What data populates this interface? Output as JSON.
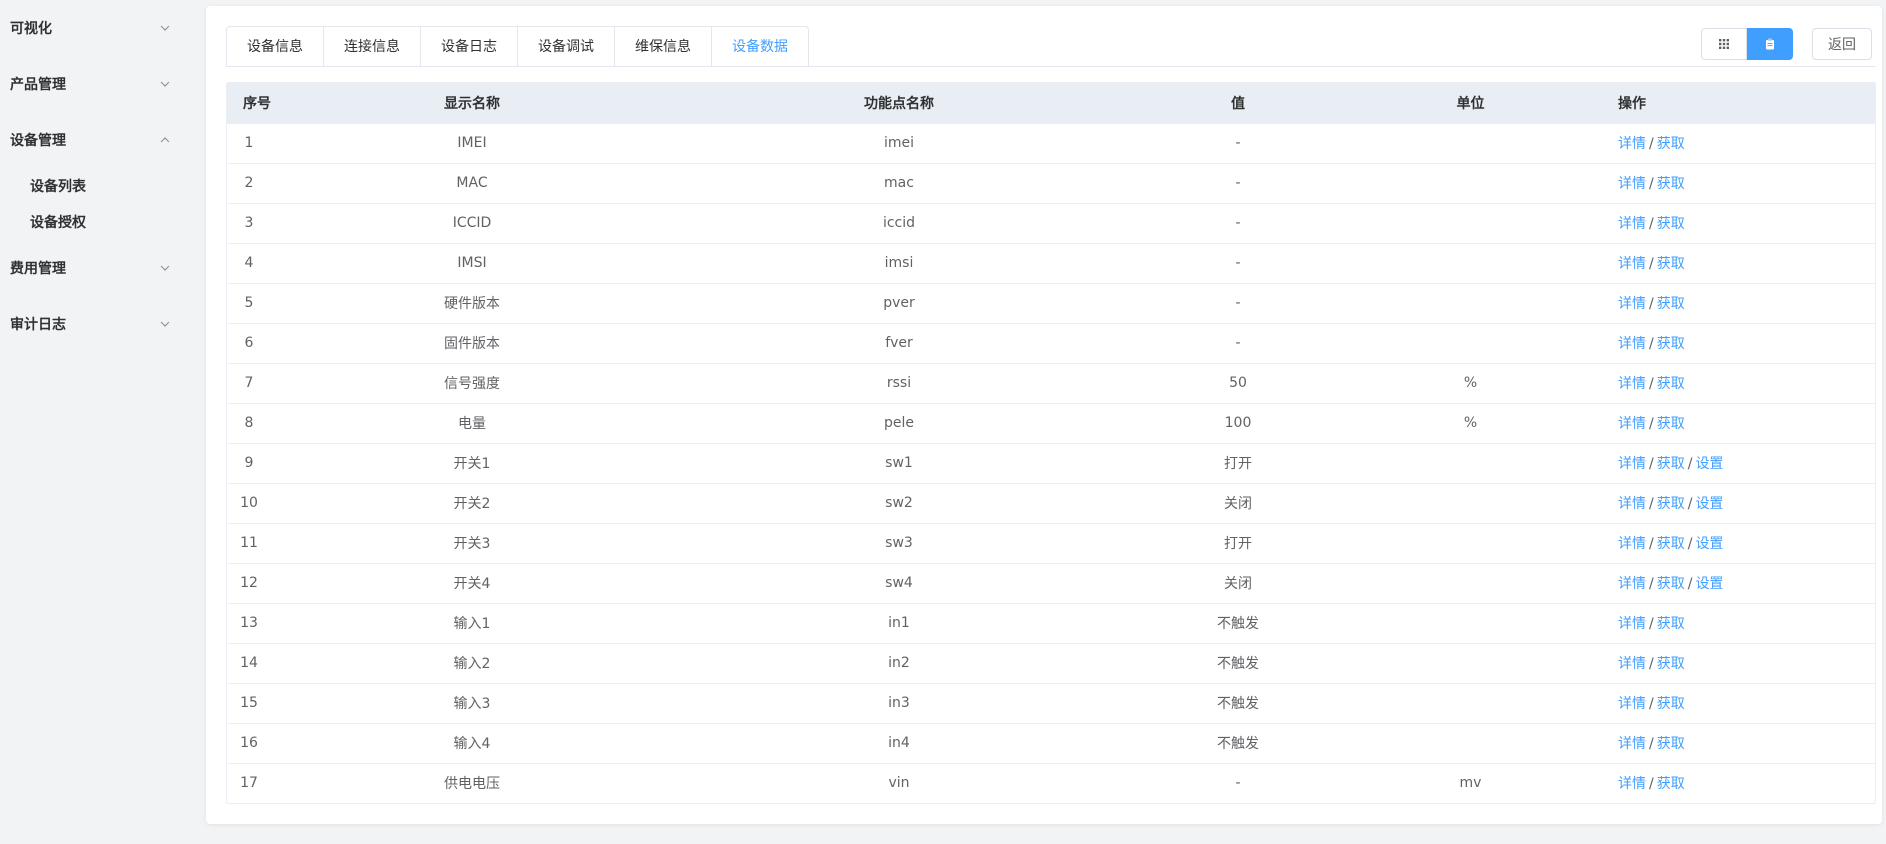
{
  "sidebar": {
    "groups": [
      {
        "label": "可视化",
        "expanded": false
      },
      {
        "label": "产品管理",
        "expanded": false
      },
      {
        "label": "设备管理",
        "expanded": true,
        "children": [
          "设备列表",
          "设备授权"
        ]
      },
      {
        "label": "费用管理",
        "expanded": false
      },
      {
        "label": "审计日志",
        "expanded": false
      }
    ]
  },
  "tabs": [
    {
      "label": "设备信息",
      "active": false
    },
    {
      "label": "连接信息",
      "active": false
    },
    {
      "label": "设备日志",
      "active": false
    },
    {
      "label": "设备调试",
      "active": false
    },
    {
      "label": "维保信息",
      "active": false
    },
    {
      "label": "设备数据",
      "active": true
    }
  ],
  "toolbar": {
    "view_grid_icon": "grid-icon",
    "view_list_icon": "clipboard-icon",
    "back_label": "返回"
  },
  "colors": {
    "accent": "#409eff",
    "header_bg": "#e9eef5"
  },
  "table": {
    "headers": {
      "index": "序号",
      "display_name": "显示名称",
      "function_name": "功能点名称",
      "value": "值",
      "unit": "单位",
      "ops": "操作"
    },
    "op_labels": {
      "detail": "详情",
      "fetch": "获取",
      "set": "设置",
      "sep": "/"
    },
    "rows": [
      {
        "index": "1",
        "display_name": "IMEI",
        "function_name": "imei",
        "value": "-",
        "unit": "",
        "settable": false
      },
      {
        "index": "2",
        "display_name": "MAC",
        "function_name": "mac",
        "value": "-",
        "unit": "",
        "settable": false
      },
      {
        "index": "3",
        "display_name": "ICCID",
        "function_name": "iccid",
        "value": "-",
        "unit": "",
        "settable": false
      },
      {
        "index": "4",
        "display_name": "IMSI",
        "function_name": "imsi",
        "value": "-",
        "unit": "",
        "settable": false
      },
      {
        "index": "5",
        "display_name": "硬件版本",
        "function_name": "pver",
        "value": "-",
        "unit": "",
        "settable": false
      },
      {
        "index": "6",
        "display_name": "固件版本",
        "function_name": "fver",
        "value": "-",
        "unit": "",
        "settable": false
      },
      {
        "index": "7",
        "display_name": "信号强度",
        "function_name": "rssi",
        "value": "50",
        "unit": "%",
        "settable": false
      },
      {
        "index": "8",
        "display_name": "电量",
        "function_name": "pele",
        "value": "100",
        "unit": "%",
        "settable": false
      },
      {
        "index": "9",
        "display_name": "开关1",
        "function_name": "sw1",
        "value": "打开",
        "unit": "",
        "settable": true
      },
      {
        "index": "10",
        "display_name": "开关2",
        "function_name": "sw2",
        "value": "关闭",
        "unit": "",
        "settable": true
      },
      {
        "index": "11",
        "display_name": "开关3",
        "function_name": "sw3",
        "value": "打开",
        "unit": "",
        "settable": true
      },
      {
        "index": "12",
        "display_name": "开关4",
        "function_name": "sw4",
        "value": "关闭",
        "unit": "",
        "settable": true
      },
      {
        "index": "13",
        "display_name": "输入1",
        "function_name": "in1",
        "value": "不触发",
        "unit": "",
        "settable": false
      },
      {
        "index": "14",
        "display_name": "输入2",
        "function_name": "in2",
        "value": "不触发",
        "unit": "",
        "settable": false
      },
      {
        "index": "15",
        "display_name": "输入3",
        "function_name": "in3",
        "value": "不触发",
        "unit": "",
        "settable": false
      },
      {
        "index": "16",
        "display_name": "输入4",
        "function_name": "in4",
        "value": "不触发",
        "unit": "",
        "settable": false
      },
      {
        "index": "17",
        "display_name": "供电电压",
        "function_name": "vin",
        "value": "-",
        "unit": "mv",
        "settable": false
      }
    ]
  }
}
